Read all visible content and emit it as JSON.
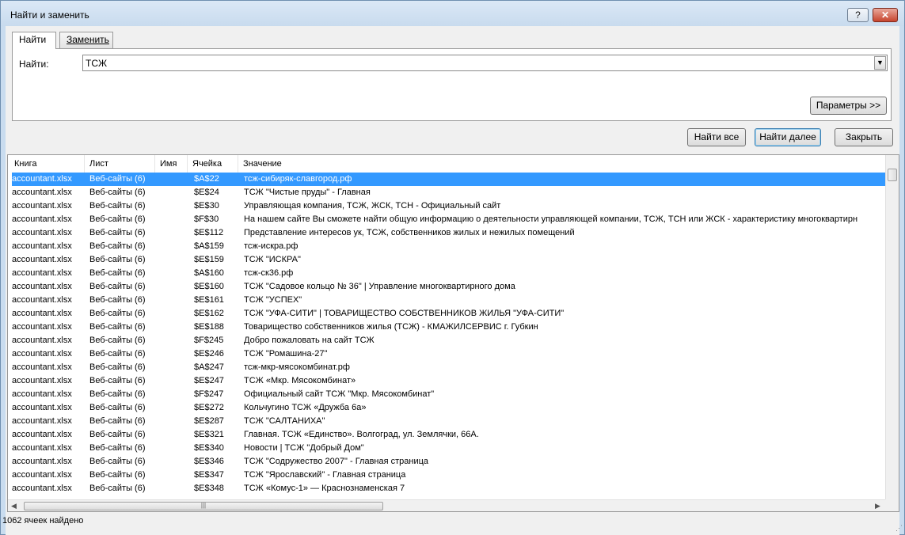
{
  "window": {
    "title": "Найти и заменить",
    "help_label": "?",
    "close_label": "✕"
  },
  "tabs": [
    {
      "label": "Найти"
    },
    {
      "label": "Заменить"
    }
  ],
  "find": {
    "label": "Найти:",
    "value": "ТСЖ"
  },
  "buttons": {
    "params": "Параметры >>",
    "find_all": "Найти все",
    "find_next": "Найти далее",
    "close": "Закрыть"
  },
  "columns": [
    "Книга",
    "Лист",
    "Имя",
    "Ячейка",
    "Значение"
  ],
  "rows": [
    [
      "accountant.xlsx",
      "Веб-сайты (6)",
      "",
      "$A$22",
      "тсж-сибиряк-славгород.рф"
    ],
    [
      "accountant.xlsx",
      "Веб-сайты (6)",
      "",
      "$E$24",
      "ТСЖ \"Чистые пруды\" - Главная"
    ],
    [
      "accountant.xlsx",
      "Веб-сайты (6)",
      "",
      "$E$30",
      "Управляющая компания, ТСЖ, ЖСК, ТСН - Официальный сайт"
    ],
    [
      "accountant.xlsx",
      "Веб-сайты (6)",
      "",
      "$F$30",
      "На нашем сайте Вы сможете найти общую информацию о деятельности управляющей компании, ТСЖ, ТСН или ЖСК - характеристику многоквартирн"
    ],
    [
      "accountant.xlsx",
      "Веб-сайты (6)",
      "",
      "$E$112",
      "Представление интересов ук, ТСЖ, собственников жилых и нежилых помещений"
    ],
    [
      "accountant.xlsx",
      "Веб-сайты (6)",
      "",
      "$A$159",
      "тсж-искра.рф"
    ],
    [
      "accountant.xlsx",
      "Веб-сайты (6)",
      "",
      "$E$159",
      "ТСЖ \"ИСКРА\""
    ],
    [
      "accountant.xlsx",
      "Веб-сайты (6)",
      "",
      "$A$160",
      "тсж-ск36.рф"
    ],
    [
      "accountant.xlsx",
      "Веб-сайты (6)",
      "",
      "$E$160",
      "ТСЖ \"Садовое кольцо № 36\" | Управление многоквартирного дома"
    ],
    [
      "accountant.xlsx",
      "Веб-сайты (6)",
      "",
      "$E$161",
      "ТСЖ \"УСПЕХ\""
    ],
    [
      "accountant.xlsx",
      "Веб-сайты (6)",
      "",
      "$E$162",
      "ТСЖ \"УФА-СИТИ\" | ТОВАРИЩЕСТВО СОБСТВЕННИКОВ ЖИЛЬЯ \"УФА-СИТИ\""
    ],
    [
      "accountant.xlsx",
      "Веб-сайты (6)",
      "",
      "$E$188",
      "Товарищество собственников жилья (ТСЖ) - КМАЖИЛСЕРВИС г. Губкин"
    ],
    [
      "accountant.xlsx",
      "Веб-сайты (6)",
      "",
      "$F$245",
      "Добро пожаловать на сайт ТСЖ"
    ],
    [
      "accountant.xlsx",
      "Веб-сайты (6)",
      "",
      "$E$246",
      "ТСЖ \"Ромашина-27\""
    ],
    [
      "accountant.xlsx",
      "Веб-сайты (6)",
      "",
      "$A$247",
      "тсж-мкр-мясокомбинат.рф"
    ],
    [
      "accountant.xlsx",
      "Веб-сайты (6)",
      "",
      "$E$247",
      "ТСЖ «Мкр. Мясокомбинат»"
    ],
    [
      "accountant.xlsx",
      "Веб-сайты (6)",
      "",
      "$F$247",
      "Официальный сайт ТСЖ \"Мкр. Мясокомбинат\""
    ],
    [
      "accountant.xlsx",
      "Веб-сайты (6)",
      "",
      "$E$272",
      "Кольчугино ТСЖ «Дружба 6а»"
    ],
    [
      "accountant.xlsx",
      "Веб-сайты (6)",
      "",
      "$E$287",
      "ТСЖ \"САЛТАНИХА\""
    ],
    [
      "accountant.xlsx",
      "Веб-сайты (6)",
      "",
      "$E$321",
      "Главная. ТСЖ «Единство». Волгоград, ул. Землячки, 66А."
    ],
    [
      "accountant.xlsx",
      "Веб-сайты (6)",
      "",
      "$E$340",
      "Новости | ТСЖ \"Добрый Дом\""
    ],
    [
      "accountant.xlsx",
      "Веб-сайты (6)",
      "",
      "$E$346",
      "ТСЖ \"Содружество 2007\" - Главная страница"
    ],
    [
      "accountant.xlsx",
      "Веб-сайты (6)",
      "",
      "$E$347",
      "ТСЖ \"Ярославский\" - Главная страница"
    ],
    [
      "accountant.xlsx",
      "Веб-сайты (6)",
      "",
      "$E$348",
      "ТСЖ «Комус-1» — Краснознаменская 7"
    ]
  ],
  "status": "1062 ячеек найдено",
  "colors": {
    "selection": "#3399ff",
    "dialog_bg": "#f0f0f0"
  }
}
